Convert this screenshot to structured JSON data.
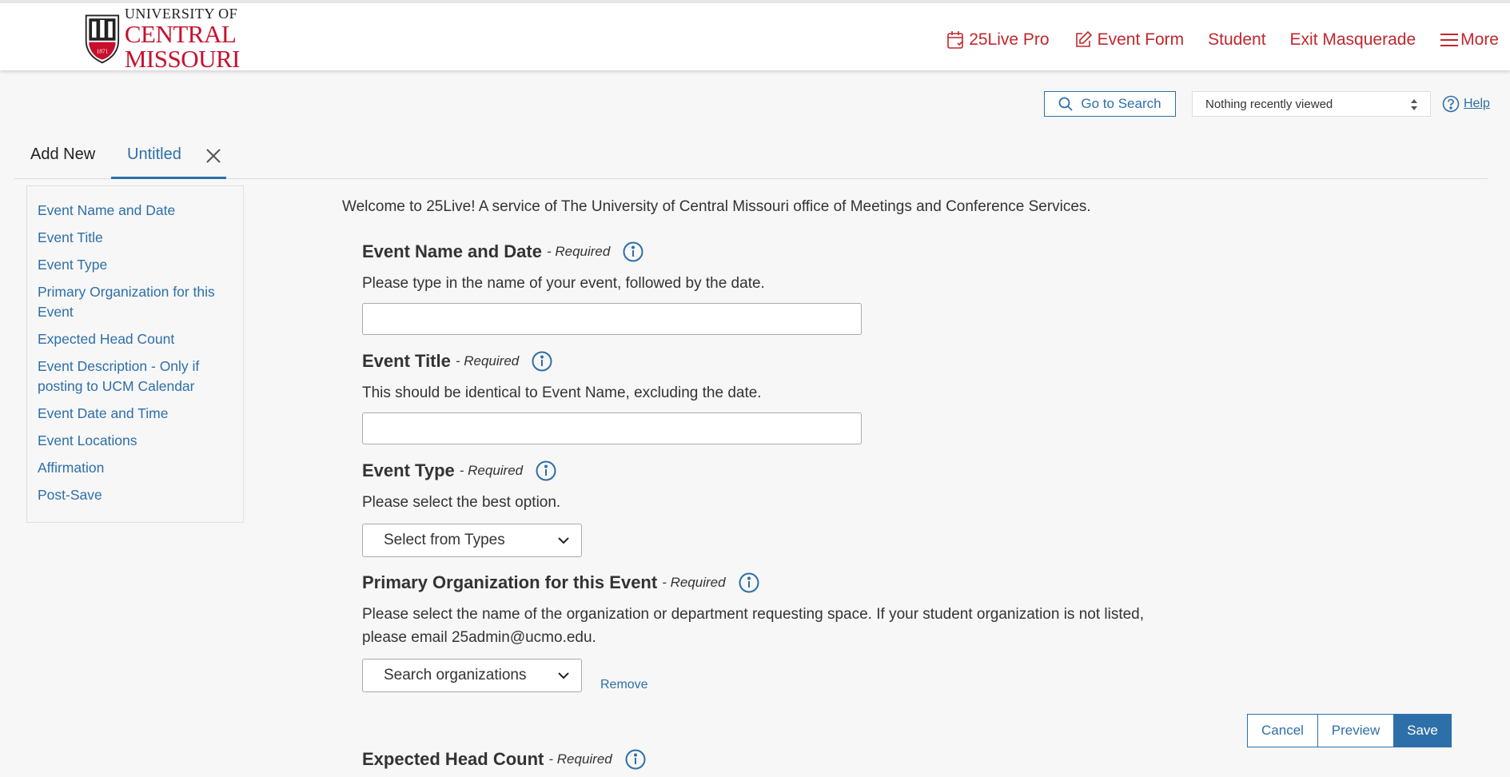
{
  "header": {
    "logo": {
      "line1": "UNIVERSITY OF",
      "line2": "CENTRAL",
      "line3": "MISSOURI",
      "seal_year": "1871"
    },
    "nav": [
      {
        "label": "25Live Pro",
        "icon": "calendar-icon"
      },
      {
        "label": "Event Form",
        "icon": "edit-icon"
      },
      {
        "label": "Student"
      },
      {
        "label": "Exit Masquerade"
      },
      {
        "label": "More",
        "icon": "hamburger-icon"
      }
    ]
  },
  "toolbar": {
    "search_label": "Go to Search",
    "recent_label": "Nothing recently viewed",
    "help_label": "Help"
  },
  "tabs": [
    {
      "label": "Add New"
    },
    {
      "label": "Untitled",
      "active": true
    }
  ],
  "sidenav": [
    "Event Name and Date",
    "Event Title",
    "Event Type",
    "Primary Organization for this Event",
    "Expected Head Count",
    "Event Description - Only if posting to UCM Calendar",
    "Event Date and Time",
    "Event Locations",
    "Affirmation",
    "Post-Save"
  ],
  "welcome": "Welcome to 25Live! A service of The University of Central Missouri office of Meetings and Conference Services.",
  "required_label": "- Required",
  "sections": {
    "name_date": {
      "title": "Event Name and Date",
      "desc": "Please type in the name of your event, followed by the date."
    },
    "title": {
      "title": "Event Title",
      "desc": "This should be identical to Event Name, excluding the date."
    },
    "type": {
      "title": "Event Type",
      "desc": "Please select the best option.",
      "select": "Select from Types"
    },
    "org": {
      "title": "Primary Organization for this Event",
      "desc": "Please select the name of the organization or department requesting space. If your student organization is not listed, please email 25admin@ucmo.edu.",
      "select": "Search organizations",
      "remove": "Remove"
    },
    "headcount": {
      "title": "Expected Head Count"
    }
  },
  "actions": {
    "cancel": "Cancel",
    "preview": "Preview",
    "save": "Save"
  },
  "colors": {
    "brand_red": "#c0272d",
    "link_blue": "#2d6fa8"
  }
}
